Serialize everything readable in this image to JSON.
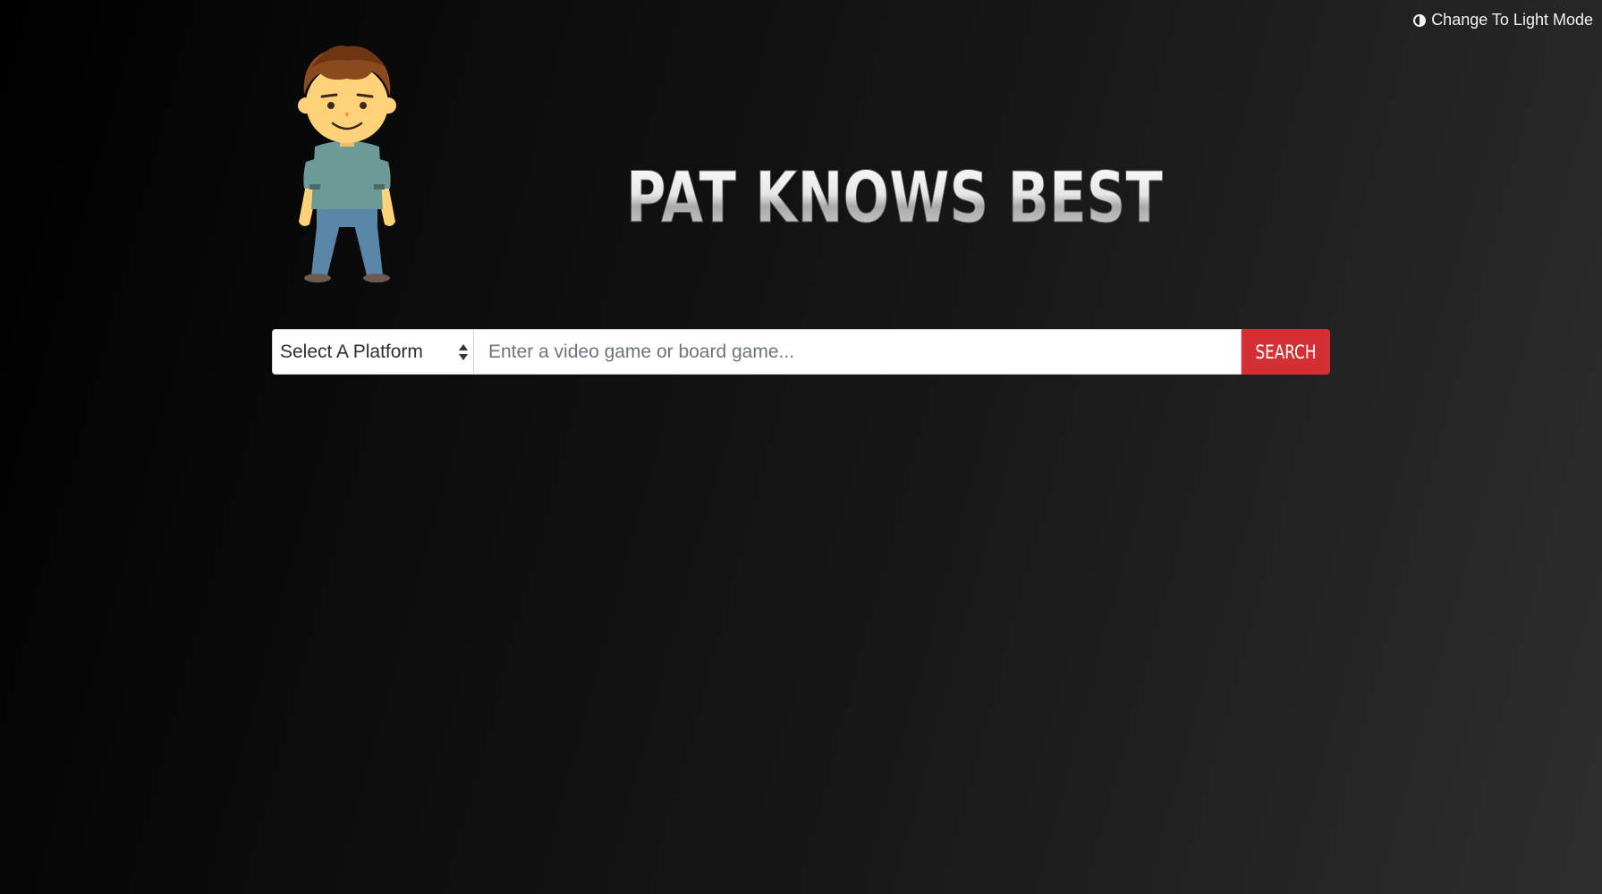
{
  "header": {
    "mode_toggle_icon": "half-circle-contrast-icon",
    "mode_toggle_label": "Change To Light Mode"
  },
  "branding": {
    "mascot": "cartoon-boy-mascot",
    "logo_text": "PAT KNOWS BEST"
  },
  "search": {
    "platform_select_value": "Select A Platform",
    "input_placeholder": "Enter a video game or board game...",
    "input_value": "",
    "button_label": "SEARCH"
  },
  "colors": {
    "accent_button": "#d32f34",
    "background_dark": "#000000",
    "background_light": "#2e2e2e"
  }
}
